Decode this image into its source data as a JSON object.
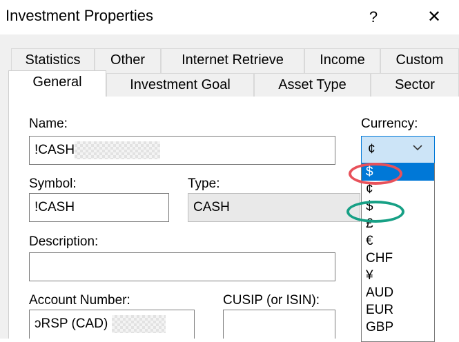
{
  "window": {
    "title": "Investment Properties",
    "help_label": "?",
    "close_label": "✕"
  },
  "tabs": {
    "row1": [
      "Statistics",
      "Other",
      "Internet Retrieve",
      "Income",
      "Custom"
    ],
    "row2": [
      "General",
      "Investment Goal",
      "Asset Type",
      "Sector"
    ],
    "active": "General"
  },
  "form": {
    "name_label": "Name:",
    "name_value": "!CASH",
    "currency_label": "Currency:",
    "currency_value": "¢",
    "symbol_label": "Symbol:",
    "symbol_value": "!CASH",
    "type_label": "Type:",
    "type_value": "CASH",
    "description_label": "Description:",
    "description_value": "",
    "account_number_label": "Account Number:",
    "account_number_value": "ᴐRSP (CAD)",
    "cusip_label": "CUSIP (or ISIN):",
    "cusip_value": ""
  },
  "currency_dropdown": {
    "options": [
      "$",
      "¢",
      "$",
      "£",
      "€",
      "CHF",
      "¥",
      "AUD",
      "EUR",
      "GBP"
    ],
    "selected_index": 0
  },
  "annotations": {
    "red_ring_color": "#e8515a",
    "green_ring_color": "#17a085"
  }
}
